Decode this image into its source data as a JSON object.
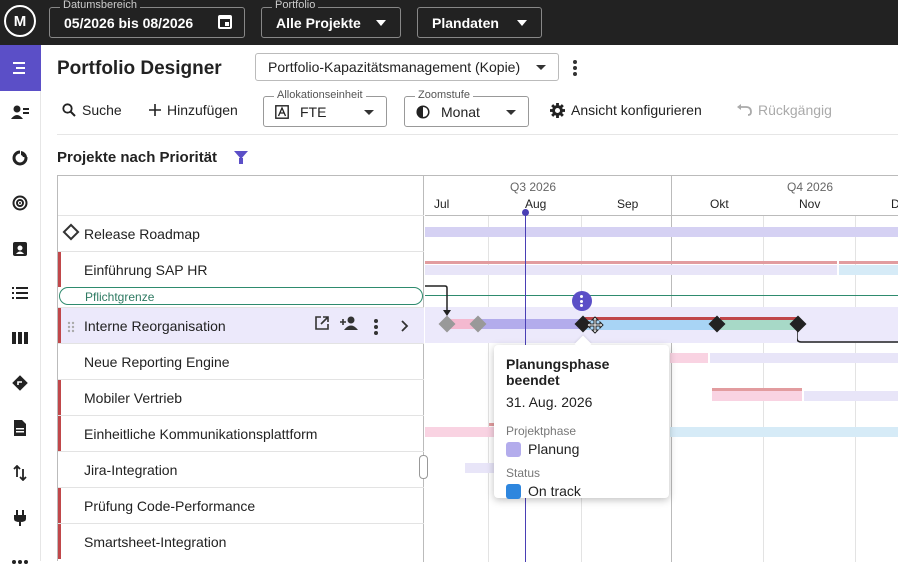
{
  "topbar": {
    "logo": "M",
    "date_range": {
      "legend": "Datumsbereich",
      "value": "05/2026 bis 08/2026",
      "icon": "calendar-icon"
    },
    "portfolio": {
      "legend": "Portfolio",
      "value": "Alle Projekte"
    },
    "dataset": {
      "value": "Plandaten"
    }
  },
  "leftnav": {
    "items": [
      "menu-icon",
      "people-icon",
      "donut-icon",
      "target-icon",
      "badge-icon",
      "list-icon",
      "columns-icon",
      "route-icon",
      "document-icon",
      "swap-icon",
      "plug-icon",
      "more-icon"
    ]
  },
  "header": {
    "title": "Portfolio Designer",
    "view": "Portfolio-Kapazitätsmanagement (Kopie)"
  },
  "toolbar": {
    "search": "Suche",
    "add": "Hinzufügen",
    "allocation_legend": "Allokationseinheit",
    "allocation_value": "FTE",
    "zoom_legend": "Zoomstufe",
    "zoom_value": "Monat",
    "configure": "Ansicht konfigurieren",
    "undo": "Rückgängig"
  },
  "section": {
    "title": "Projekte nach Priorität"
  },
  "timeline": {
    "quarters": [
      "Q3 2026",
      "Q4 2026"
    ],
    "months": [
      "Jul",
      "Aug",
      "Sep",
      "Okt",
      "Nov",
      "D"
    ]
  },
  "rows": [
    {
      "label": "Release Roadmap",
      "marked": false
    },
    {
      "label": "Einführung SAP HR",
      "marked": true
    },
    {
      "label": "Interne Reorganisation",
      "marked": true,
      "active": true
    },
    {
      "label": "Neue Reporting Engine",
      "marked": false
    },
    {
      "label": "Mobiler Vertrieb",
      "marked": true
    },
    {
      "label": "Einheitliche Kommunikationsplattform",
      "marked": true
    },
    {
      "label": "Jira-Integration",
      "marked": false
    },
    {
      "label": "Prüfung Code-Performance",
      "marked": true
    },
    {
      "label": "Smartsheet-Integration",
      "marked": true
    }
  ],
  "mandatory_limit": "Pflichtgrenze",
  "tooltip": {
    "title": "Planungsphase beendet",
    "date": "31. Aug. 2026",
    "phase_label": "Projektphase",
    "phase_value": "Planung",
    "phase_color": "#b3acec",
    "status_label": "Status",
    "status_value": "On track",
    "status_color": "#2e86de"
  },
  "colors": {
    "accent": "#5b4fc7",
    "marker": "#c0474a",
    "today": "#4a3fb5"
  }
}
